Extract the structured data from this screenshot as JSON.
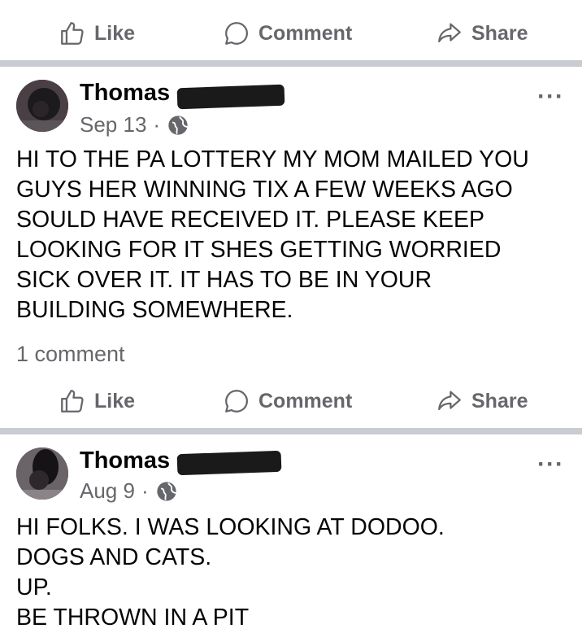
{
  "actions": {
    "like": "Like",
    "comment": "Comment",
    "share": "Share"
  },
  "posts": [
    {
      "author": "Thomas",
      "date": "Sep 13",
      "separator": "·",
      "more": "···",
      "lines": [
        "HI  TO THE PA LOTTERY  MY MOM MAILED YOU",
        "GUYS  HER WINNING TIX A FEW WEEKS AGO",
        "SOULD HAVE RECEIVED IT.  PLEASE KEEP",
        "LOOKING FOR IT SHES  GETTING WORRIED",
        "SICK  OVER IT. IT HAS TO BE IN YOUR",
        "BUILDING SOMEWHERE."
      ],
      "comment_count": "1 comment"
    },
    {
      "author": "Thomas",
      "date": "Aug 9",
      "separator": "·",
      "more": "···",
      "lines": [
        "HI FOLKS. I WAS LOOKING AT DODOO.",
        "DOGS AND CATS.",
        "UP.",
        "BE THROWN IN A PIT"
      ]
    }
  ],
  "colors": {
    "text": "#050505",
    "secondary": "#65676b",
    "divider": "#c9ccd1"
  }
}
